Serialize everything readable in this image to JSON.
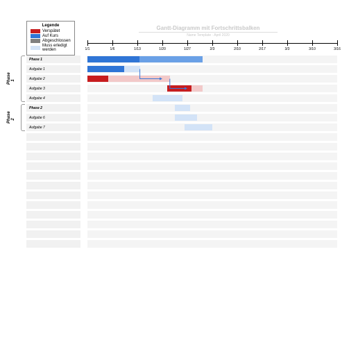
{
  "title": "Gantt-Diagramm mit Fortschrittsbalken",
  "subtitle": "Name Template · April 2020",
  "legend": {
    "title": "Legende",
    "items": [
      {
        "label": "Verspätet",
        "color": "#c71c1e"
      },
      {
        "label": "Auf Kurs",
        "color": "#2f75d6"
      },
      {
        "label": "Abgeschlossen",
        "color": "#808080"
      },
      {
        "label": "Muss erledigt werden",
        "color": "#d3e3f7"
      }
    ]
  },
  "timeline": {
    "ticks": [
      "1/1",
      "1/6",
      "1/13",
      "1/20",
      "1/27",
      "2/3",
      "2/10",
      "2/17",
      "3/3",
      "3/10",
      "3/16"
    ]
  },
  "phases": [
    {
      "label": "Phase 1",
      "row_start": 0,
      "row_end": 4
    },
    {
      "label": "Phase 2",
      "row_start": 5,
      "row_end": 7
    }
  ],
  "colors": {
    "late": "#c71c1e",
    "late_light": "#f2c9c9",
    "ontrack": "#2f75d6",
    "ontrack_mid": "#6aa0e6",
    "ontrack_light": "#d3e3f7",
    "done": "#808080"
  },
  "chart_data": {
    "type": "gantt",
    "x_unit": "tick_index",
    "rows": [
      {
        "label": "Phase 1",
        "start": 0.0,
        "end": 4.6,
        "status": "ontrack",
        "progress": 0.45,
        "tier": "phase"
      },
      {
        "label": "Aufgabe 1",
        "start": 0.0,
        "end": 2.1,
        "status": "ontrack",
        "progress": 0.7
      },
      {
        "label": "Aufgabe 2",
        "start": 0.0,
        "end": 3.3,
        "status": "late",
        "progress": 0.25
      },
      {
        "label": "Aufgabe 3",
        "start": 3.2,
        "end": 4.6,
        "status": "late",
        "progress": 0.7
      },
      {
        "label": "Aufgabe 4",
        "start": 2.6,
        "end": 3.8,
        "status": "ontrack_light",
        "progress": 0.0
      },
      {
        "label": "Phase 2",
        "start": 3.5,
        "end": 4.1,
        "status": "ontrack_light",
        "progress": 0.0,
        "tier": "phase"
      },
      {
        "label": "Aufgabe 6",
        "start": 3.5,
        "end": 4.4,
        "status": "ontrack_light",
        "progress": 0.0
      },
      {
        "label": "Aufgabe 7",
        "start": 3.9,
        "end": 5.0,
        "status": "ontrack_light",
        "progress": 0.0
      }
    ],
    "dependencies": [
      {
        "from_row": 1,
        "to_row": 2,
        "at_x": 2.1,
        "to_x": 3.0
      },
      {
        "from_row": 2,
        "to_row": 3,
        "at_x": 3.3,
        "to_x": 4.0
      }
    ],
    "empty_rows": 12
  }
}
